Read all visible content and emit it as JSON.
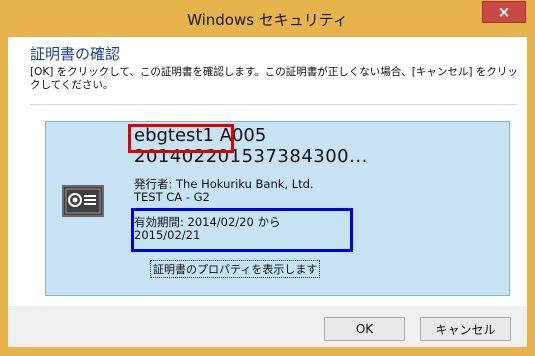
{
  "window": {
    "title": "Windows セキュリティ",
    "close_glyph": "×"
  },
  "dialog": {
    "heading": "証明書の確認",
    "description": "[OK] をクリックして、この証明書を確認します。この証明書が正しくない場合、[キャンセル] をクリックしてください。"
  },
  "certificate": {
    "icon": "certificate-icon",
    "name": "ebgtest1 A005",
    "serial": "20140220153738430​0...",
    "issuer_line1": "発行者: The Hokuriku Bank, Ltd.",
    "issuer_line2": "TEST CA - G2",
    "validity_line1": "有効期間: 2014/02/20 から",
    "validity_line2": "2015/02/21",
    "properties_link": "証明書のプロパティを表示します"
  },
  "buttons": {
    "ok": "OK",
    "cancel": "キャンセル"
  },
  "colors": {
    "frame": "#e6b34c",
    "card": "#c7e3f3",
    "heading": "#1f3e9a",
    "highlight_red": "#e00000",
    "highlight_blue": "#0000e0"
  }
}
